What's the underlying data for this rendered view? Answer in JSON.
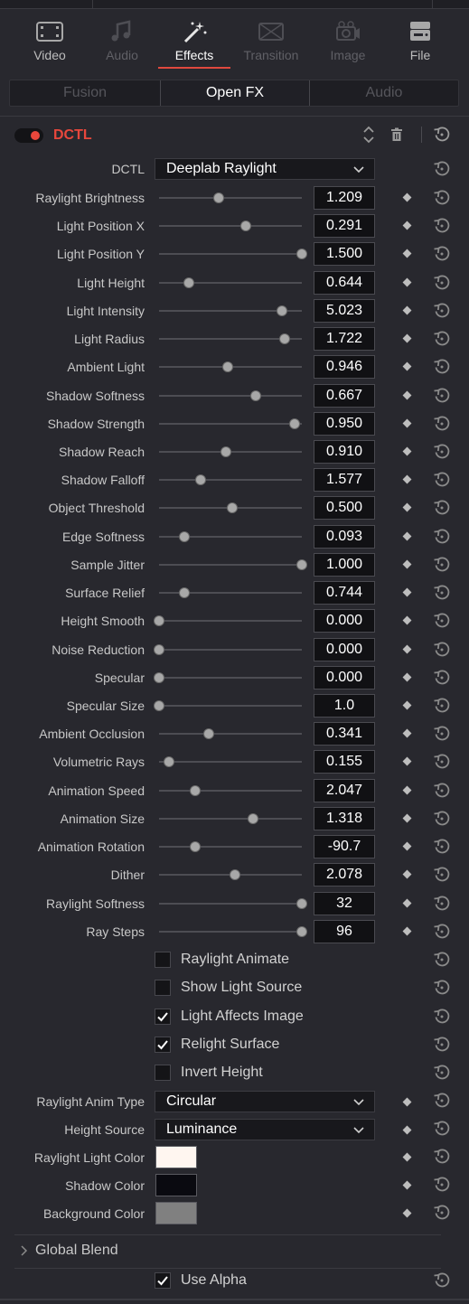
{
  "tabs": [
    {
      "label": "Video",
      "icon": "film-icon",
      "state": "normal"
    },
    {
      "label": "Audio",
      "icon": "music-note-icon",
      "state": "dim"
    },
    {
      "label": "Effects",
      "icon": "magic-wand-icon",
      "state": "active"
    },
    {
      "label": "Transition",
      "icon": "transition-icon",
      "state": "dim"
    },
    {
      "label": "Image",
      "icon": "camera-icon",
      "state": "dim"
    },
    {
      "label": "File",
      "icon": "file-icon",
      "state": "normal"
    }
  ],
  "segments": [
    "Fusion",
    "Open FX",
    "Audio"
  ],
  "segment_active": "Open FX",
  "effect": {
    "title": "DCTL",
    "enabled": true,
    "accent": "#e8473c"
  },
  "dctl": {
    "label": "DCTL",
    "value": "Deeplab Raylight"
  },
  "sliders": [
    {
      "label": "Raylight Brightness",
      "value": "1.209",
      "level": 0.42
    },
    {
      "label": "Light Position X",
      "value": "0.291",
      "level": 0.61
    },
    {
      "label": "Light Position Y",
      "value": "1.500",
      "level": 1.0
    },
    {
      "label": "Light Height",
      "value": "0.644",
      "level": 0.21
    },
    {
      "label": "Light Intensity",
      "value": "5.023",
      "level": 0.86
    },
    {
      "label": "Light Radius",
      "value": "1.722",
      "level": 0.88
    },
    {
      "label": "Ambient Light",
      "value": "0.946",
      "level": 0.48
    },
    {
      "label": "Shadow Softness",
      "value": "0.667",
      "level": 0.68
    },
    {
      "label": "Shadow Strength",
      "value": "0.950",
      "level": 0.95
    },
    {
      "label": "Shadow Reach",
      "value": "0.910",
      "level": 0.47
    },
    {
      "label": "Shadow Falloff",
      "value": "1.577",
      "level": 0.29
    },
    {
      "label": "Object Threshold",
      "value": "0.500",
      "level": 0.51
    },
    {
      "label": "Edge Softness",
      "value": "0.093",
      "level": 0.18
    },
    {
      "label": "Sample Jitter",
      "value": "1.000",
      "level": 1.0
    },
    {
      "label": "Surface Relief",
      "value": "0.744",
      "level": 0.18
    },
    {
      "label": "Height Smooth",
      "value": "0.000",
      "level": 0.0
    },
    {
      "label": "Noise Reduction",
      "value": "0.000",
      "level": 0.0
    },
    {
      "label": "Specular",
      "value": "0.000",
      "level": 0.0
    },
    {
      "label": "Specular Size",
      "value": "1.0",
      "level": 0.0
    },
    {
      "label": "Ambient Occlusion",
      "value": "0.341",
      "level": 0.35
    },
    {
      "label": "Volumetric Rays",
      "value": "0.155",
      "level": 0.07
    },
    {
      "label": "Animation Speed",
      "value": "2.047",
      "level": 0.25
    },
    {
      "label": "Animation Size",
      "value": "1.318",
      "level": 0.66
    },
    {
      "label": "Animation Rotation",
      "value": "-90.7",
      "level": 0.25
    },
    {
      "label": "Dither",
      "value": "2.078",
      "level": 0.53
    },
    {
      "label": "Raylight Softness",
      "value": "32",
      "level": 1.0
    },
    {
      "label": "Ray Steps",
      "value": "96",
      "level": 1.0
    }
  ],
  "checkboxes": [
    {
      "label": "Raylight Animate",
      "checked": false
    },
    {
      "label": "Show Light Source",
      "checked": false
    },
    {
      "label": "Light Affects Image",
      "checked": true
    },
    {
      "label": "Relight Surface",
      "checked": true
    },
    {
      "label": "Invert Height",
      "checked": false
    }
  ],
  "dropdowns": [
    {
      "label": "Raylight Anim Type",
      "value": "Circular"
    },
    {
      "label": "Height Source",
      "value": "Luminance"
    }
  ],
  "colors": [
    {
      "label": "Raylight Light Color",
      "value": "#fff6f0"
    },
    {
      "label": "Shadow Color",
      "value": "#0a0a10"
    },
    {
      "label": "Background Color",
      "value": "#808080"
    }
  ],
  "global_blend": {
    "label": "Global Blend",
    "expanded": false
  },
  "use_alpha": {
    "label": "Use Alpha",
    "checked": true
  }
}
